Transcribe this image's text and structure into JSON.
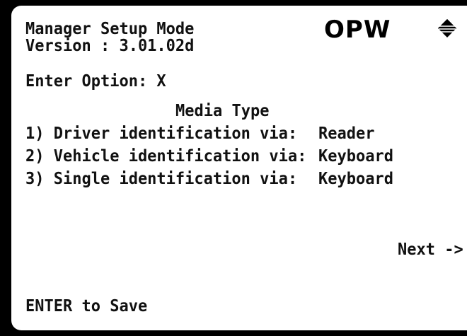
{
  "screen": {
    "title": "Manager Setup Mode",
    "version": "Version : 3.01.02d",
    "enter_option": "Enter Option: X",
    "section_heading": "Media Type",
    "options": [
      {
        "label": "1) Driver identification via:",
        "value": "Reader"
      },
      {
        "label": "2) Vehicle identification via:",
        "value": "Keyboard"
      },
      {
        "label": "3) Single identification via:",
        "value": "Keyboard"
      }
    ],
    "next_label": "Next ->",
    "save_hint": "ENTER to Save"
  },
  "logo": {
    "text": "OPW",
    "icon": "diamond-logo-icon",
    "color": "#000000"
  },
  "colors": {
    "background": "#ffffff",
    "text": "#111111",
    "bezel": "#000000"
  }
}
